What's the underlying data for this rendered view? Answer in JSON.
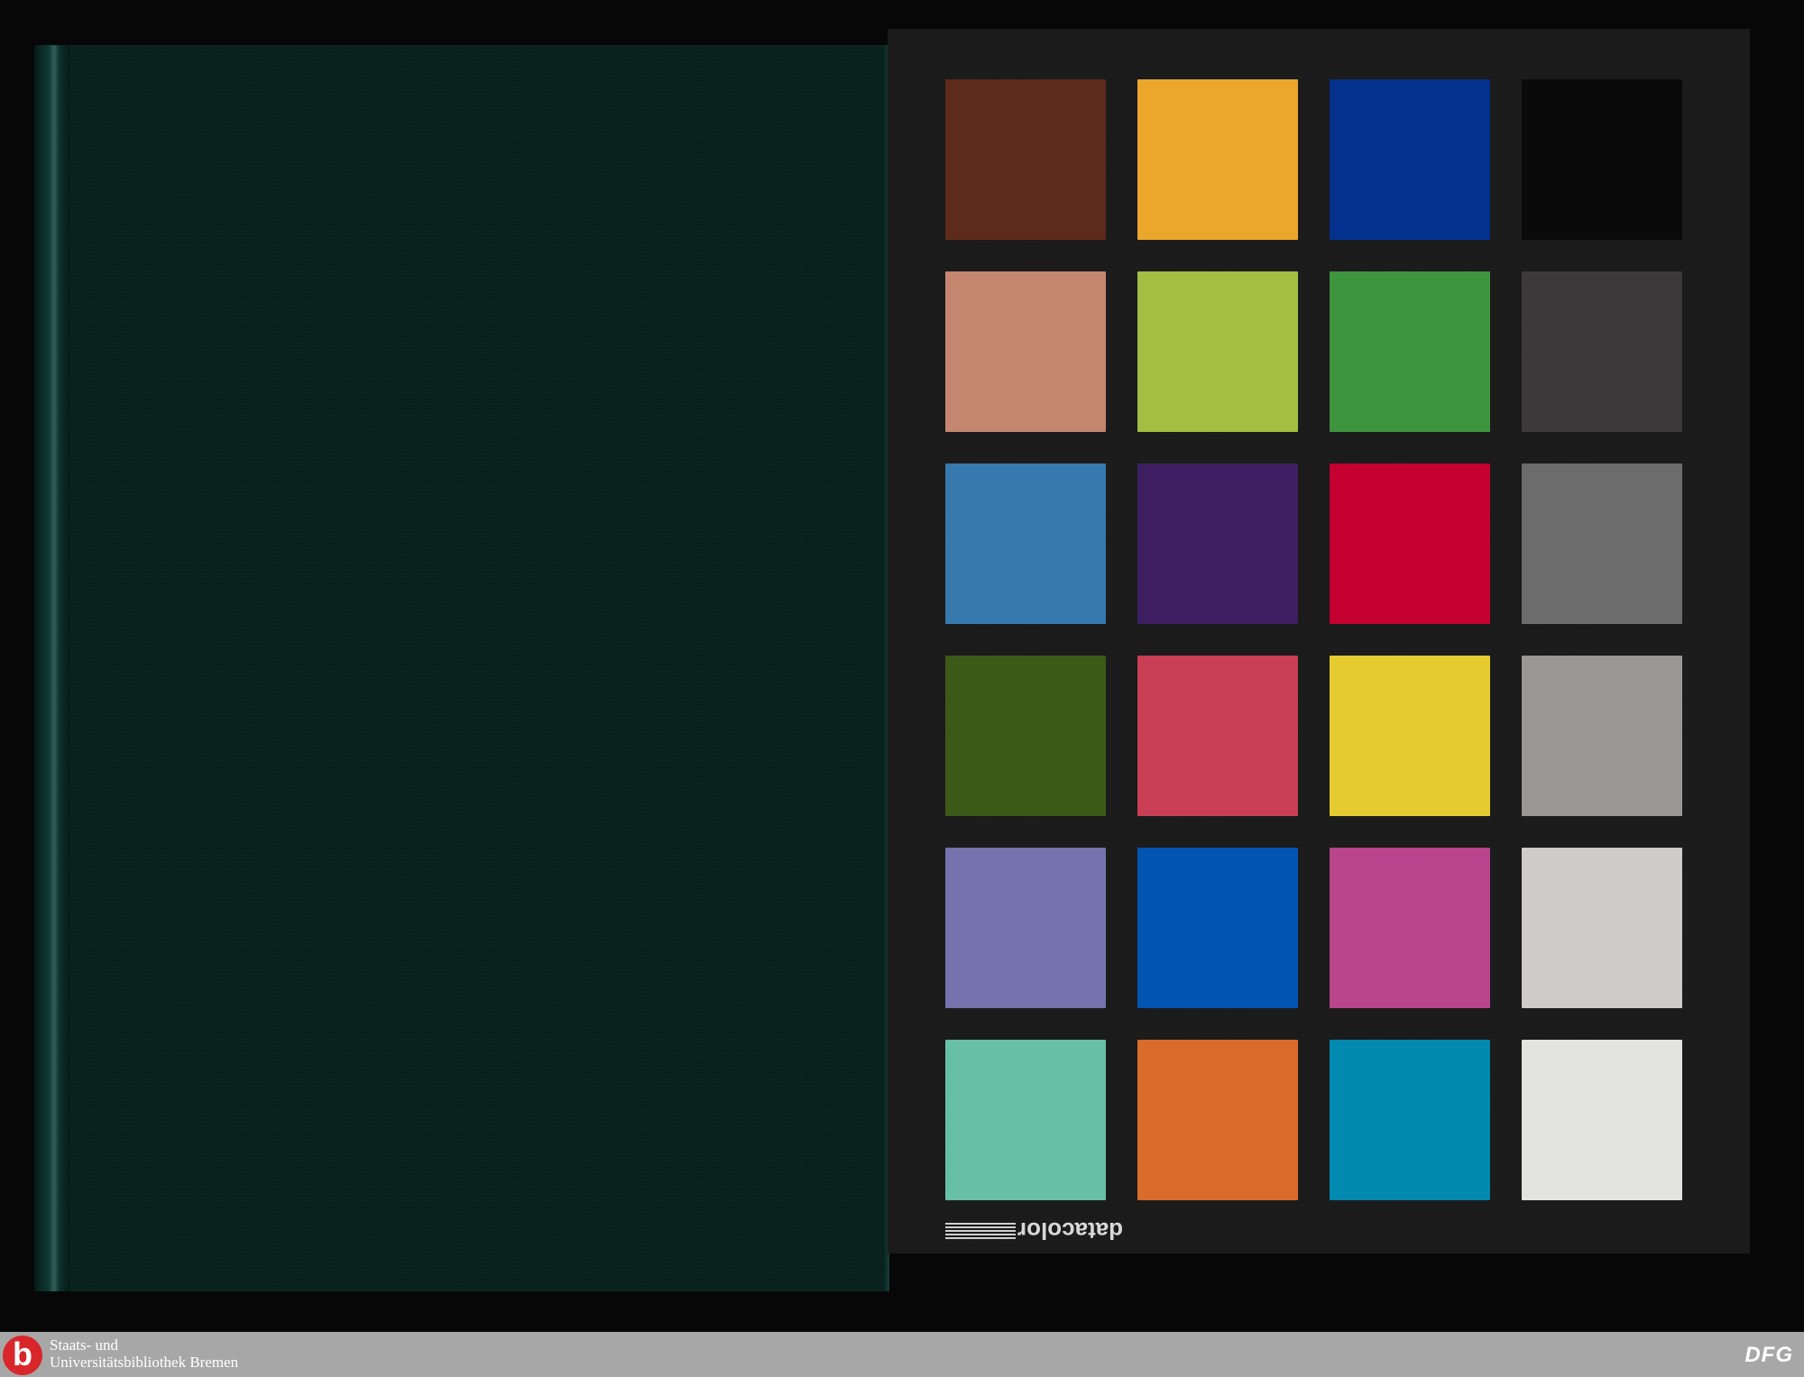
{
  "color_checker": {
    "brand": "datacolor",
    "swatches": [
      "#5e2a1b",
      "#eba72b",
      "#05318e",
      "#0a0a0a",
      "#c5866f",
      "#a4be43",
      "#3f953f",
      "#3b393a",
      "#3879ad",
      "#3e1f62",
      "#c30030",
      "#6d6c6c",
      "#3b5a17",
      "#c93f55",
      "#e5cb30",
      "#9a9797",
      "#7572ad",
      "#0254b2",
      "#b8448c",
      "#cdcccb",
      "#67c0a6",
      "#db6b2a",
      "#0289af",
      "#e3e3e1"
    ]
  },
  "book": {
    "cover_color": "#08211d"
  },
  "footer": {
    "logo_letter": "b",
    "org_line1": "Staats- und",
    "org_line2": "Universitätsbibliothek Bremen",
    "dfg_label": "DFG"
  }
}
